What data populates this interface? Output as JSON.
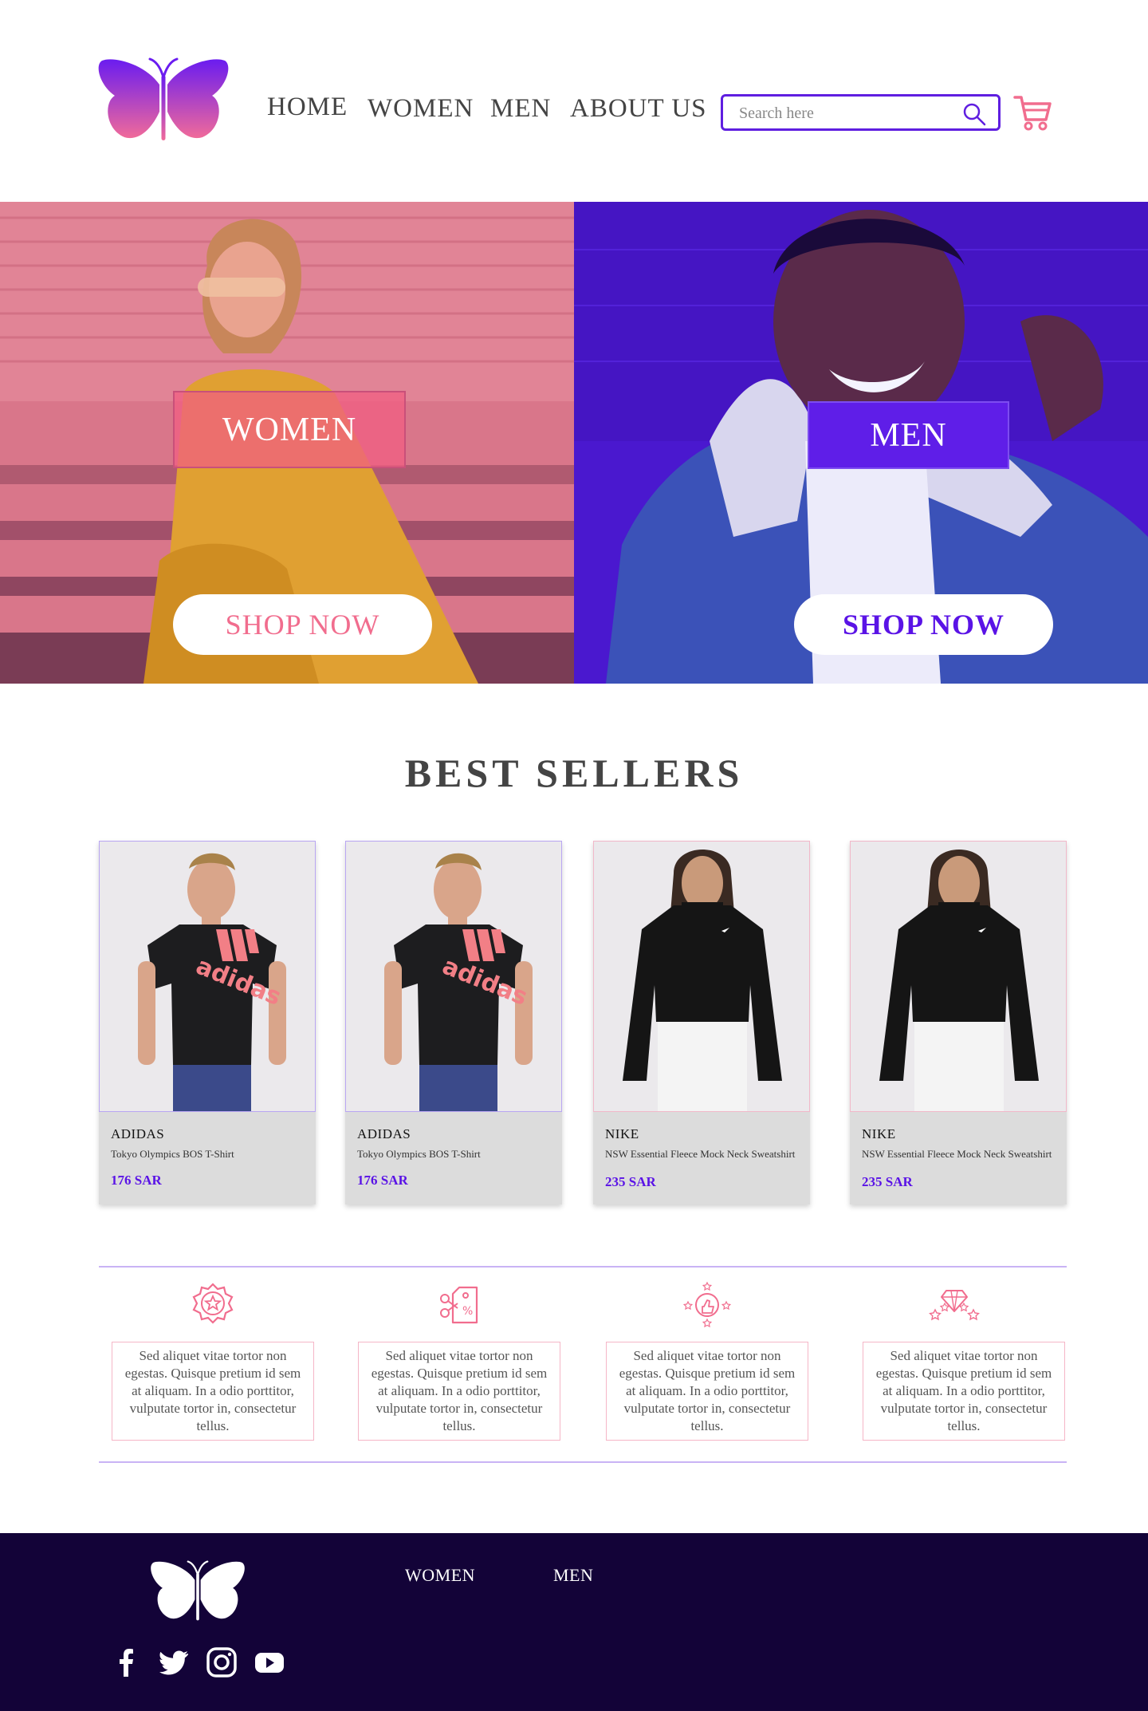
{
  "header": {
    "logo": "butterfly-logo",
    "nav": [
      {
        "label": "HOME"
      },
      {
        "label": "WOMEN"
      },
      {
        "label": "MEN"
      },
      {
        "label": "ABOUT US"
      }
    ],
    "search": {
      "placeholder": "Search here",
      "value": ""
    },
    "cart_icon": "shopping-cart-icon"
  },
  "hero": {
    "women": {
      "label": "WOMEN",
      "cta": "SHOP NOW"
    },
    "men": {
      "label": "MEN",
      "cta": "SHOP NOW"
    }
  },
  "best_sellers": {
    "title": "BEST SELLERS",
    "products": [
      {
        "brand": "ADIDAS",
        "name": "Tokyo Olympics BOS T-Shirt",
        "price": "176 SAR"
      },
      {
        "brand": "ADIDAS",
        "name": "Tokyo Olympics BOS T-Shirt",
        "price": "176 SAR"
      },
      {
        "brand": "NIKE",
        "name": "NSW Essential Fleece Mock Neck Sweatshirt",
        "price": "235 SAR"
      },
      {
        "brand": "NIKE",
        "name": "NSW Essential Fleece Mock Neck Sweatshirt",
        "price": "235 SAR"
      }
    ]
  },
  "features": [
    {
      "icon": "badge-star-icon",
      "text": "Sed aliquet vitae tortor non egestas. Quisque pretium id sem at aliquam. In a odio porttitor, vulputate tortor in, consectetur tellus."
    },
    {
      "icon": "discount-tag-icon",
      "text": "Sed aliquet vitae tortor non egestas. Quisque pretium id sem at aliquam. In a odio porttitor, vulputate tortor in, consectetur tellus."
    },
    {
      "icon": "thumbs-up-stars-icon",
      "text": "Sed aliquet vitae tortor non egestas. Quisque pretium id sem at aliquam. In a odio porttitor, vulputate tortor in, consectetur tellus."
    },
    {
      "icon": "diamond-stars-icon",
      "text": "Sed aliquet vitae tortor non egestas. Quisque pretium id sem at aliquam. In a odio porttitor, vulputate tortor in, consectetur tellus."
    }
  ],
  "footer": {
    "links": [
      {
        "label": "WOMEN"
      },
      {
        "label": "MEN"
      }
    ],
    "socials": [
      "facebook-icon",
      "twitter-icon",
      "instagram-icon",
      "youtube-icon"
    ]
  },
  "colors": {
    "accent_purple": "#5f1ee0",
    "accent_pink": "#f16d8e",
    "footer_bg": "#130338"
  }
}
